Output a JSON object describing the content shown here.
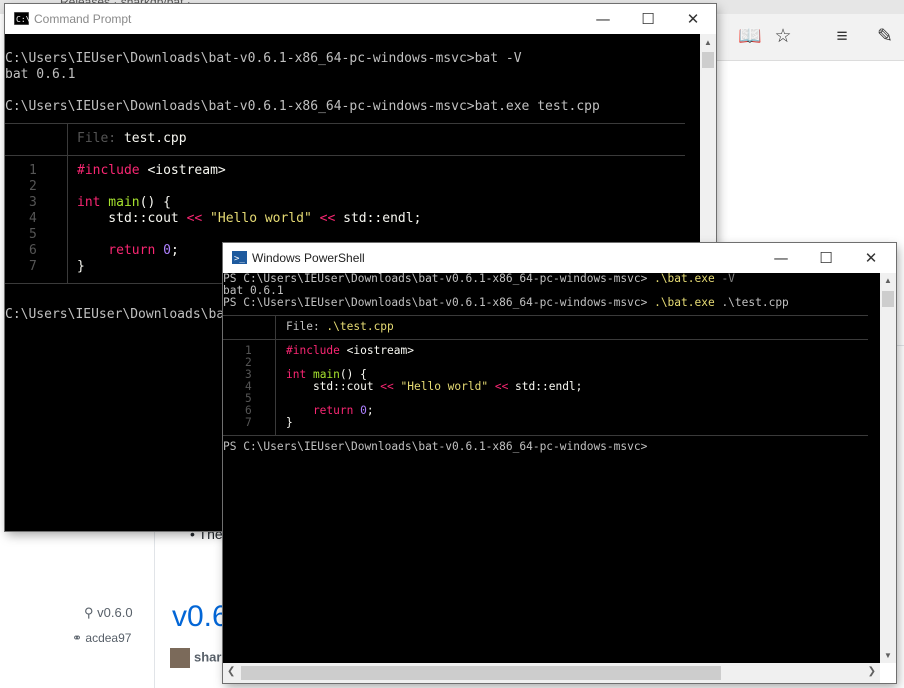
{
  "browser": {
    "tab_title": "Releases · sharkdp/bat ·",
    "release_tag": "v0.6.0",
    "release_commit": "acdea97",
    "release_title": "v0.6",
    "release_author": "shar",
    "release_bullet": "• The"
  },
  "cmd": {
    "title": "Command Prompt",
    "line1": "C:\\Users\\IEUser\\Downloads\\bat-v0.6.1-x86_64-pc-windows-msvc>bat -V",
    "line2": "bat 0.6.1",
    "line3": "C:\\Users\\IEUser\\Downloads\\bat-v0.6.1-x86_64-pc-windows-msvc>bat.exe test.cpp",
    "file_label": "File: ",
    "file_name": "test.cpp",
    "prompt_after": "C:\\Users\\IEUser\\Downloads\\ba"
  },
  "ps": {
    "title": "Windows PowerShell",
    "prompt_prefix": "PS C:\\Users\\IEUser\\Downloads\\bat-v0.6.1-x86_64-pc-windows-msvc> ",
    "cmd1_exe": ".\\bat.exe",
    "cmd1_arg": " -V",
    "version": "bat 0.6.1",
    "cmd2_exe": ".\\bat.exe",
    "cmd2_arg": " .\\test.cpp",
    "file_label": "File: ",
    "file_name": ".\\test.cpp",
    "final_prompt": "PS C:\\Users\\IEUser\\Downloads\\bat-v0.6.1-x86_64-pc-windows-msvc>"
  },
  "code": {
    "line_numbers": [
      "1",
      "2",
      "3",
      "4",
      "5",
      "6",
      "7"
    ],
    "include_kw": "#include",
    "include_hdr": " <iostream>",
    "int_kw": "int",
    "main_fn": " main",
    "main_rest": "() {",
    "cout": "    std::cout ",
    "op1": "<<",
    "hello": " \"Hello world\" ",
    "op2": "<<",
    "endl": " std::endl;",
    "return_kw": "    return",
    "zero": " 0",
    "semi": ";",
    "close": "}"
  },
  "window_controls": {
    "minimize": "—",
    "maximize": "☐",
    "close": "✕"
  },
  "colors": {
    "keyword": "#f92672",
    "string": "#e6db74",
    "function": "#a6e22e",
    "number": "#ae81ff"
  }
}
